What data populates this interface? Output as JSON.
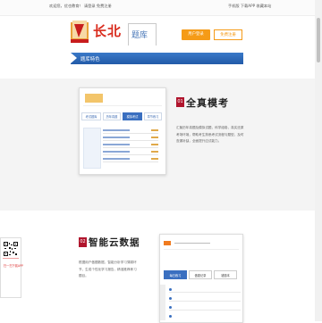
{
  "topbar": {
    "left_text": "欢迎您，优也教育！ 请登录 免费注册",
    "right_text": "手机版 下载APP 收藏本站"
  },
  "header": {
    "logo_text": "长北",
    "logo_sub": "题库",
    "btn_primary": "用户登录",
    "btn_secondary": "免费注册"
  },
  "bluebar": {
    "title": "题库特色"
  },
  "feature1": {
    "icon_label": "01",
    "title": "全真模考",
    "desc": "汇聚历年真题及模拟试题，科学组卷，真实还原考场环境，帮助考生熟悉考试流程与题型，及时查漏补缺，全面提升应试能力。",
    "mock_tabs": [
      "考试题库",
      "历年真题",
      "模拟考试",
      "章节练习"
    ]
  },
  "qr": {
    "label": "扫一扫下载APP"
  },
  "feature2": {
    "icon_label": "02",
    "title": "智能云数据",
    "desc": "根据用户做题数据，智能分析学习薄弱环节，生成个性化学习报告，精准推荐练习题目。",
    "mock_tabs": [
      "每日练习",
      "做题记录",
      "错题本"
    ]
  },
  "colors": {
    "brand_red": "#d92b1d",
    "accent_orange": "#f59b17",
    "blue": "#2f68b9",
    "icon_red": "#b0152d"
  }
}
